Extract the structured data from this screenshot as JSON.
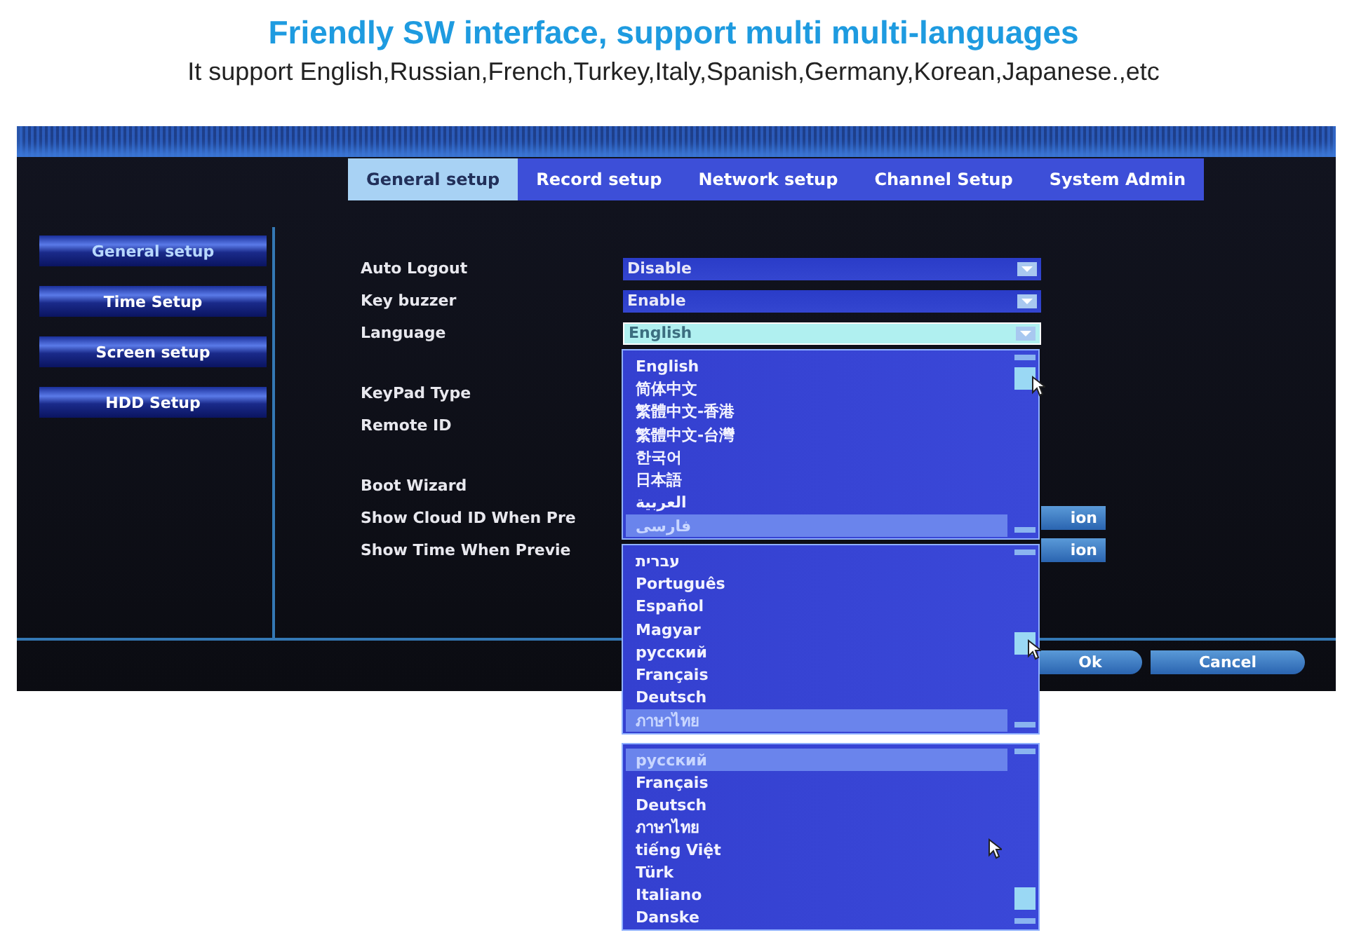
{
  "headline": {
    "title": "Friendly SW interface, support multi multi-languages",
    "subtitle": "It support English,Russian,French,Turkey,Italy,Spanish,Germany,Korean,Japanese.,etc"
  },
  "tabs": [
    {
      "label": "General setup",
      "selected": true
    },
    {
      "label": "Record setup",
      "selected": false
    },
    {
      "label": "Network setup",
      "selected": false
    },
    {
      "label": "Channel Setup",
      "selected": false
    },
    {
      "label": "System Admin",
      "selected": false
    }
  ],
  "sidebar": {
    "items": [
      {
        "label": "General setup",
        "selected": true
      },
      {
        "label": "Time Setup",
        "selected": false
      },
      {
        "label": "Screen setup",
        "selected": false
      },
      {
        "label": "HDD Setup",
        "selected": false
      }
    ]
  },
  "setting_groups": [
    [
      {
        "label": "Auto Logout",
        "value": "Disable",
        "focused": false
      },
      {
        "label": "Key buzzer",
        "value": "Enable",
        "focused": false
      },
      {
        "label": "Language",
        "value": "English",
        "focused": true
      }
    ],
    [
      {
        "label": "KeyPad Type"
      },
      {
        "label": "Remote ID"
      }
    ],
    [
      {
        "label": "Boot Wizard"
      },
      {
        "label": "Show Cloud ID When Pre",
        "button": "ion"
      },
      {
        "label": "Show Time When Previe",
        "button": "ion"
      }
    ]
  ],
  "footer_buttons": [
    "Ok",
    "Cancel"
  ],
  "language_lists": [
    [
      {
        "label": "English",
        "selected": false
      },
      {
        "label": "简体中文",
        "selected": false
      },
      {
        "label": "繁體中文-香港",
        "selected": false
      },
      {
        "label": "繁體中文-台灣",
        "selected": false
      },
      {
        "label": "한국어",
        "selected": false
      },
      {
        "label": "日本語",
        "selected": false
      },
      {
        "label": "العربية",
        "selected": false
      },
      {
        "label": "فارسی",
        "selected": true
      }
    ],
    [
      {
        "label": "עברית",
        "selected": false
      },
      {
        "label": "Português",
        "selected": false
      },
      {
        "label": "Español",
        "selected": false
      },
      {
        "label": "Magyar",
        "selected": false
      },
      {
        "label": "русский",
        "selected": false
      },
      {
        "label": "Français",
        "selected": false
      },
      {
        "label": "Deutsch",
        "selected": false
      },
      {
        "label": "ภาษาไทย",
        "selected": true
      }
    ],
    [
      {
        "label": "русский",
        "selected": true
      },
      {
        "label": "Français",
        "selected": false
      },
      {
        "label": "Deutsch",
        "selected": false
      },
      {
        "label": "ภาษาไทย",
        "selected": false
      },
      {
        "label": "tiếng Việt",
        "selected": false
      },
      {
        "label": "Türk",
        "selected": false
      },
      {
        "label": "Italiano",
        "selected": false
      },
      {
        "label": "Danske",
        "selected": false
      }
    ]
  ]
}
